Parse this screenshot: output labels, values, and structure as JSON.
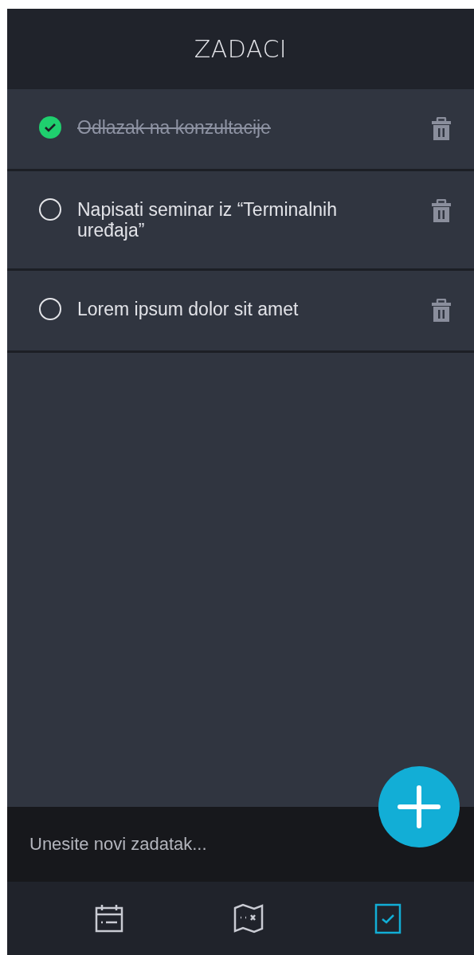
{
  "header": {
    "title": "ZADACI"
  },
  "tasks": [
    {
      "text": "Odlazak na konzultacije",
      "checked": true
    },
    {
      "text": "Napisati seminar iz “Terminalnih uređaja”",
      "checked": false
    },
    {
      "text": "Lorem ipsum dolor sit amet",
      "checked": false
    }
  ],
  "new_task": {
    "placeholder": "Unesite novi zadatak..."
  },
  "nav": [
    {
      "kind": "calendar",
      "selected": false
    },
    {
      "kind": "map",
      "selected": false
    },
    {
      "kind": "tasks",
      "selected": true
    }
  ]
}
